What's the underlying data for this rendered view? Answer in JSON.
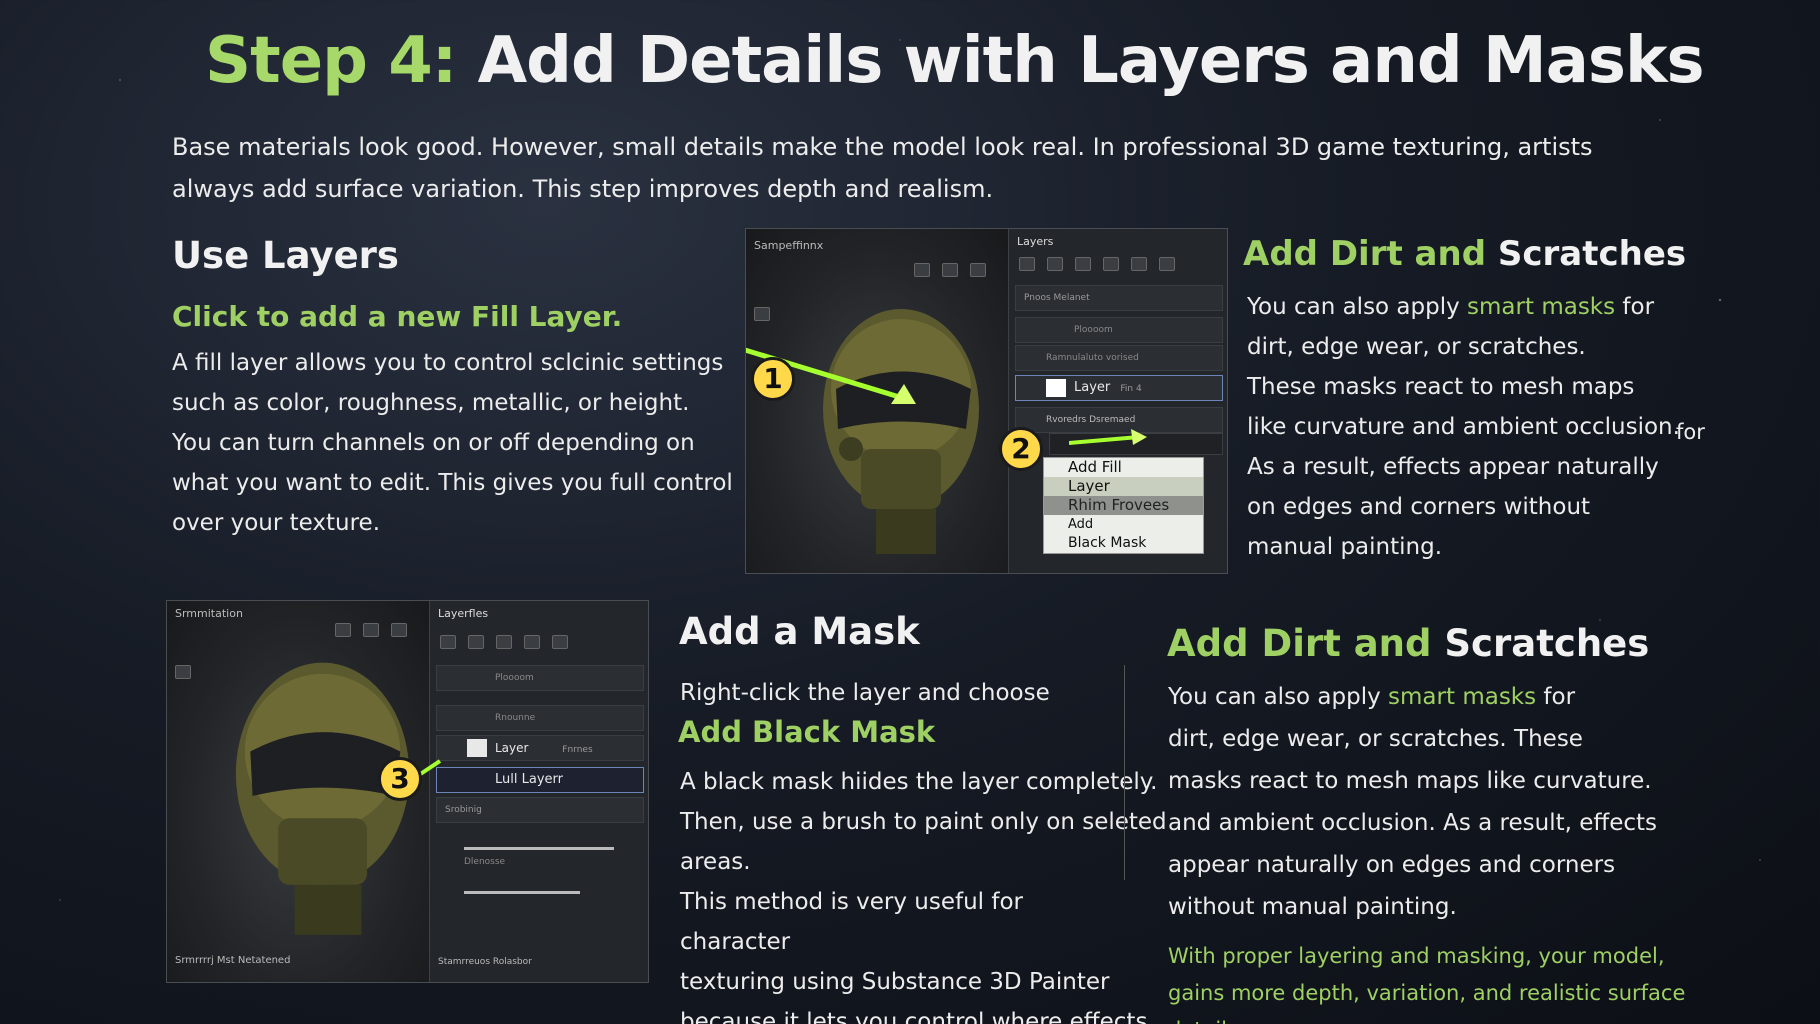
{
  "title": {
    "step": "Step 4:",
    "text": "Add Details with Layers and Masks"
  },
  "intro": "Base materials look good. However, small details make the model look real. In professional 3D game texturing, artists always add surface variation. This step improves depth and realism.",
  "use_layers": {
    "heading": "Use Layers",
    "subheading": "Click to add a new Fill Layer.",
    "lines": [
      "A fill layer allows you to control sclcinic settings",
      "such as color, roughness, metallic, or height.",
      "You can turn channels on or off depending on",
      "what you want to edit. This gives you full control",
      "over your texture."
    ]
  },
  "dirt1": {
    "heading_green": "Add Dirt and",
    "heading_white": "Scratches",
    "line1_pre": "You can also apply ",
    "line1_green": "smart masks",
    "line1_post": " for",
    "lines": [
      "dirt, edge wear, or scratches.",
      "These masks react to mesh maps",
      "like curvature and ambient occlusion.",
      "As a result, effects appear naturally",
      "on edges and corners without",
      "manual painting."
    ],
    "stray": "for"
  },
  "add_mask": {
    "heading": "Add a Mask",
    "line1": "Right-click the layer and choose",
    "subheading": "Add Black Mask",
    "lines": [
      "A black mask hiides the layer completely.",
      "Then, use a brush to paint only on seleted",
      "areas.",
      "This method is very useful for character",
      "texturing using Substance 3D Painter",
      "because it lets you control where effects"
    ]
  },
  "dirt2": {
    "heading_green": "Add Dirt",
    "heading_mid": "and",
    "heading_white": "Scratches",
    "line1_pre": "You can also apply ",
    "line1_green": "smart masks",
    "line1_post": " for",
    "lines": [
      "dirt, edge wear, or scratches. These",
      "masks react to mesh maps like curvature.",
      "and ambient occlusion. As a result, effects",
      "appear naturally on edges and corners",
      "without manual painting."
    ],
    "footer": [
      "With proper layering and masking, your model,",
      "gains more depth, variation, and realistic surface",
      "detail."
    ]
  },
  "screenshot_top": {
    "viewport_title": "Sampeffinnx",
    "layers_title": "Layers",
    "row_props": "Pnoos    Melanet",
    "row_a": "Ploooom",
    "row_b": "Ramnulaluto vorised",
    "layer_label": "Layer",
    "layer_tag": "Fin 4",
    "row_c": "Rvoredrs Dsremaed",
    "menu_items": [
      "Add Fill",
      "Layer",
      "Rhim Frovees",
      "Add",
      "Black Mask"
    ],
    "badge1": "1",
    "badge2": "2"
  },
  "screenshot_bottom": {
    "viewport_title": "Srmmitation",
    "layers_title": "Layerfles",
    "row_a": "Ploooom",
    "row_b": "Rnounne",
    "layer_label": "Layer",
    "layer_tag": "Fnrnes",
    "fill_label": "Lull Layerr",
    "row_c": "Srobinig",
    "row_d": "Dlenosse",
    "footer_left": "Srmrrrrj Mst Netatened",
    "footer_right": "Stamrreuos Rolasbor",
    "badge3": "3"
  },
  "colors": {
    "accent_green": "#9fd063",
    "badge_yellow": "#ffd94a",
    "arrow_green": "#a6ff2e"
  }
}
